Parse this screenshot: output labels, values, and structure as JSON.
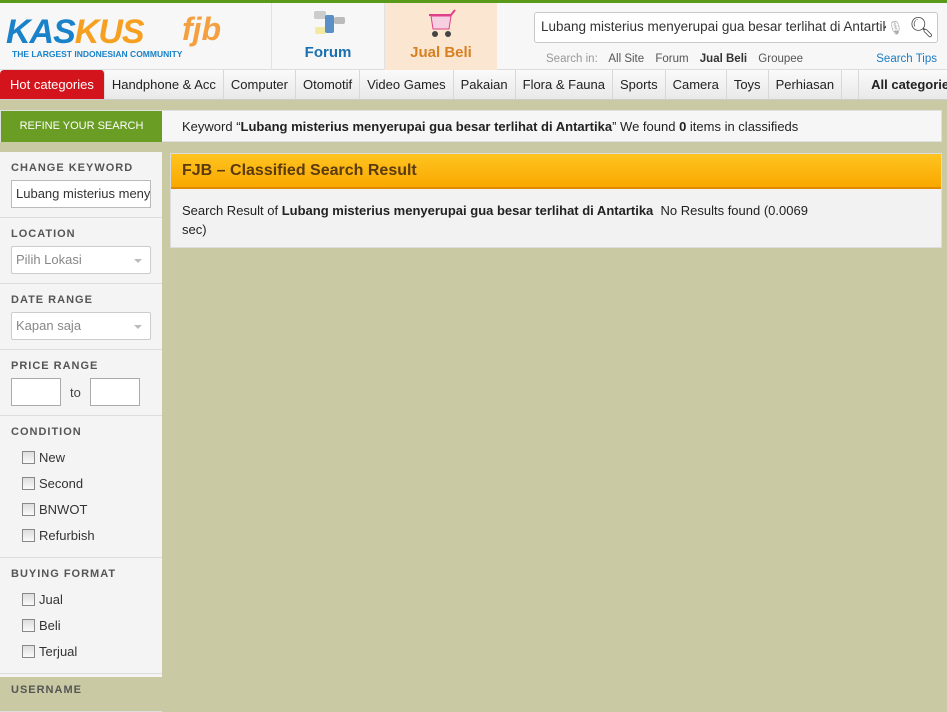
{
  "logo": {
    "text": "KASKUS",
    "sub": "FJB",
    "tagline": "THE LARGEST INDONESIAN COMMUNITY"
  },
  "tabs": [
    {
      "label": "Forum",
      "icon": "forum-icon"
    },
    {
      "label": "Jual Beli",
      "icon": "cart-icon"
    }
  ],
  "search": {
    "value": "Lubang misterius menyerupai gua besar terlihat di Antartika",
    "search_in_label": "Search in:",
    "scopes": [
      "All Site",
      "Forum",
      "Jual Beli",
      "Groupee"
    ],
    "active_scope": "Jual Beli",
    "tips": "Search Tips"
  },
  "nav": {
    "hot": "Hot categories",
    "items": [
      "Handphone & Acc",
      "Computer",
      "Otomotif",
      "Video Games",
      "Pakaian",
      "Flora & Fauna",
      "Sports",
      "Camera",
      "Toys",
      "Perhiasan"
    ],
    "all": "All categories"
  },
  "refine": {
    "label": "REFINE YOUR SEARCH",
    "kw_prefix": "Keyword “",
    "keyword": "Lubang misterius menyerupai gua besar terlihat di Antartika",
    "kw_mid": "” We found ",
    "count": "0",
    "kw_suffix": " items in classifieds"
  },
  "sidebar": {
    "change_keyword": "CHANGE KEYWORD",
    "keyword_value": "Lubang misterius menyerupai gua besar terlihat di Antartika",
    "location": "LOCATION",
    "location_value": "Pilih Lokasi",
    "date_range": "DATE RANGE",
    "date_value": "Kapan saja",
    "price_range": "PRICE RANGE",
    "to": "to",
    "condition": "CONDITION",
    "conditions": [
      "New",
      "Second",
      "BNWOT",
      "Refurbish"
    ],
    "buying_format": "BUYING FORMAT",
    "formats": [
      "Jual",
      "Beli",
      "Terjual"
    ],
    "username": "USERNAME"
  },
  "result": {
    "title": "FJB – Classified Search Result",
    "prefix": "Search Result of ",
    "keyword": "Lubang misterius menyerupai gua besar terlihat di Antartika",
    "suffix": "  No Results found (0.0069 sec)"
  }
}
